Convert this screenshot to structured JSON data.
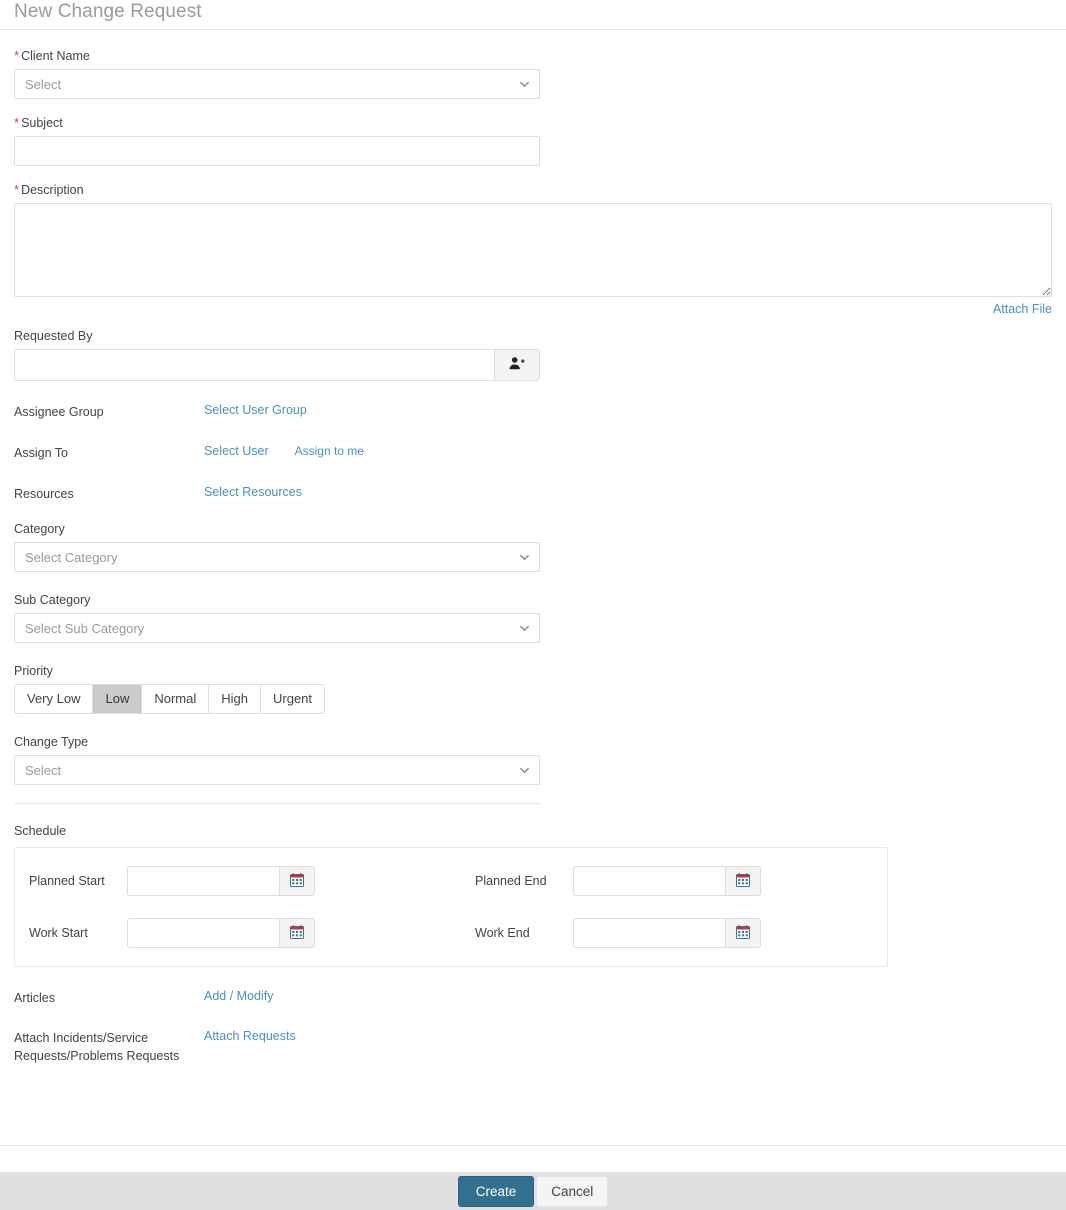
{
  "header": {
    "title": "New Change Request"
  },
  "form": {
    "client_name": {
      "label": "Client Name",
      "required_marker": "*",
      "placeholder": "Select",
      "value": ""
    },
    "subject": {
      "label": "Subject",
      "required_marker": "*",
      "value": "",
      "placeholder": ""
    },
    "description": {
      "label": "Description",
      "required_marker": "*",
      "value": "",
      "placeholder": ""
    },
    "attach_file_link": "Attach File",
    "requested_by": {
      "label": "Requested By",
      "value": "",
      "placeholder": "",
      "picker_icon": "add-user-icon"
    },
    "assignee_group": {
      "label": "Assignee Group",
      "link": "Select User Group"
    },
    "assign_to": {
      "label": "Assign To",
      "link": "Select User",
      "link_secondary": "Assign to me"
    },
    "resources": {
      "label": "Resources",
      "link": "Select Resources"
    },
    "category": {
      "label": "Category",
      "placeholder": "Select Category",
      "value": ""
    },
    "sub_category": {
      "label": "Sub Category",
      "placeholder": "Select Sub Category",
      "value": ""
    },
    "priority": {
      "label": "Priority",
      "options": [
        "Very Low",
        "Low",
        "Normal",
        "High",
        "Urgent"
      ],
      "selected": "Low"
    },
    "change_type": {
      "label": "Change Type",
      "placeholder": "Select",
      "value": ""
    },
    "schedule": {
      "label": "Schedule",
      "fields": [
        {
          "label": "Planned Start",
          "value": "",
          "icon": "calendar-icon"
        },
        {
          "label": "Planned End",
          "value": "",
          "icon": "calendar-icon"
        },
        {
          "label": "Work Start",
          "value": "",
          "icon": "calendar-icon"
        },
        {
          "label": "Work End",
          "value": "",
          "icon": "calendar-icon"
        }
      ]
    },
    "articles": {
      "label": "Articles",
      "link": "Add / Modify"
    },
    "attach_requests": {
      "label": "Attach Incidents/Service Requests/Problems Requests",
      "link": "Attach Requests"
    }
  },
  "footer": {
    "create_label": "Create",
    "cancel_label": "Cancel"
  },
  "colors": {
    "link": "#4a90c4",
    "required": "#d9443f",
    "primary_button": "#31708f",
    "footer_bar": "#e0e0e0",
    "priority_selected": "#cccccc"
  }
}
